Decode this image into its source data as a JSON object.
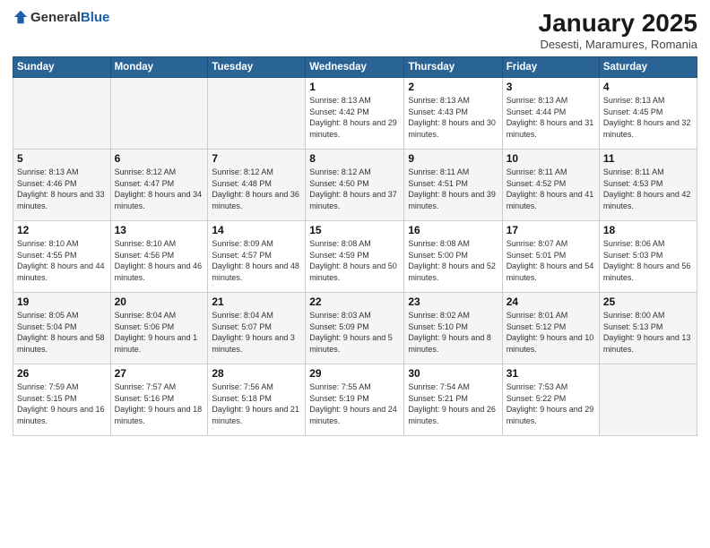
{
  "logo": {
    "general": "General",
    "blue": "Blue"
  },
  "header": {
    "title": "January 2025",
    "subtitle": "Desesti, Maramures, Romania"
  },
  "weekdays": [
    "Sunday",
    "Monday",
    "Tuesday",
    "Wednesday",
    "Thursday",
    "Friday",
    "Saturday"
  ],
  "weeks": [
    [
      {
        "day": "",
        "info": ""
      },
      {
        "day": "",
        "info": ""
      },
      {
        "day": "",
        "info": ""
      },
      {
        "day": "1",
        "info": "Sunrise: 8:13 AM\nSunset: 4:42 PM\nDaylight: 8 hours and 29 minutes."
      },
      {
        "day": "2",
        "info": "Sunrise: 8:13 AM\nSunset: 4:43 PM\nDaylight: 8 hours and 30 minutes."
      },
      {
        "day": "3",
        "info": "Sunrise: 8:13 AM\nSunset: 4:44 PM\nDaylight: 8 hours and 31 minutes."
      },
      {
        "day": "4",
        "info": "Sunrise: 8:13 AM\nSunset: 4:45 PM\nDaylight: 8 hours and 32 minutes."
      }
    ],
    [
      {
        "day": "5",
        "info": "Sunrise: 8:13 AM\nSunset: 4:46 PM\nDaylight: 8 hours and 33 minutes."
      },
      {
        "day": "6",
        "info": "Sunrise: 8:12 AM\nSunset: 4:47 PM\nDaylight: 8 hours and 34 minutes."
      },
      {
        "day": "7",
        "info": "Sunrise: 8:12 AM\nSunset: 4:48 PM\nDaylight: 8 hours and 36 minutes."
      },
      {
        "day": "8",
        "info": "Sunrise: 8:12 AM\nSunset: 4:50 PM\nDaylight: 8 hours and 37 minutes."
      },
      {
        "day": "9",
        "info": "Sunrise: 8:11 AM\nSunset: 4:51 PM\nDaylight: 8 hours and 39 minutes."
      },
      {
        "day": "10",
        "info": "Sunrise: 8:11 AM\nSunset: 4:52 PM\nDaylight: 8 hours and 41 minutes."
      },
      {
        "day": "11",
        "info": "Sunrise: 8:11 AM\nSunset: 4:53 PM\nDaylight: 8 hours and 42 minutes."
      }
    ],
    [
      {
        "day": "12",
        "info": "Sunrise: 8:10 AM\nSunset: 4:55 PM\nDaylight: 8 hours and 44 minutes."
      },
      {
        "day": "13",
        "info": "Sunrise: 8:10 AM\nSunset: 4:56 PM\nDaylight: 8 hours and 46 minutes."
      },
      {
        "day": "14",
        "info": "Sunrise: 8:09 AM\nSunset: 4:57 PM\nDaylight: 8 hours and 48 minutes."
      },
      {
        "day": "15",
        "info": "Sunrise: 8:08 AM\nSunset: 4:59 PM\nDaylight: 8 hours and 50 minutes."
      },
      {
        "day": "16",
        "info": "Sunrise: 8:08 AM\nSunset: 5:00 PM\nDaylight: 8 hours and 52 minutes."
      },
      {
        "day": "17",
        "info": "Sunrise: 8:07 AM\nSunset: 5:01 PM\nDaylight: 8 hours and 54 minutes."
      },
      {
        "day": "18",
        "info": "Sunrise: 8:06 AM\nSunset: 5:03 PM\nDaylight: 8 hours and 56 minutes."
      }
    ],
    [
      {
        "day": "19",
        "info": "Sunrise: 8:05 AM\nSunset: 5:04 PM\nDaylight: 8 hours and 58 minutes."
      },
      {
        "day": "20",
        "info": "Sunrise: 8:04 AM\nSunset: 5:06 PM\nDaylight: 9 hours and 1 minute."
      },
      {
        "day": "21",
        "info": "Sunrise: 8:04 AM\nSunset: 5:07 PM\nDaylight: 9 hours and 3 minutes."
      },
      {
        "day": "22",
        "info": "Sunrise: 8:03 AM\nSunset: 5:09 PM\nDaylight: 9 hours and 5 minutes."
      },
      {
        "day": "23",
        "info": "Sunrise: 8:02 AM\nSunset: 5:10 PM\nDaylight: 9 hours and 8 minutes."
      },
      {
        "day": "24",
        "info": "Sunrise: 8:01 AM\nSunset: 5:12 PM\nDaylight: 9 hours and 10 minutes."
      },
      {
        "day": "25",
        "info": "Sunrise: 8:00 AM\nSunset: 5:13 PM\nDaylight: 9 hours and 13 minutes."
      }
    ],
    [
      {
        "day": "26",
        "info": "Sunrise: 7:59 AM\nSunset: 5:15 PM\nDaylight: 9 hours and 16 minutes."
      },
      {
        "day": "27",
        "info": "Sunrise: 7:57 AM\nSunset: 5:16 PM\nDaylight: 9 hours and 18 minutes."
      },
      {
        "day": "28",
        "info": "Sunrise: 7:56 AM\nSunset: 5:18 PM\nDaylight: 9 hours and 21 minutes."
      },
      {
        "day": "29",
        "info": "Sunrise: 7:55 AM\nSunset: 5:19 PM\nDaylight: 9 hours and 24 minutes."
      },
      {
        "day": "30",
        "info": "Sunrise: 7:54 AM\nSunset: 5:21 PM\nDaylight: 9 hours and 26 minutes."
      },
      {
        "day": "31",
        "info": "Sunrise: 7:53 AM\nSunset: 5:22 PM\nDaylight: 9 hours and 29 minutes."
      },
      {
        "day": "",
        "info": ""
      }
    ]
  ]
}
